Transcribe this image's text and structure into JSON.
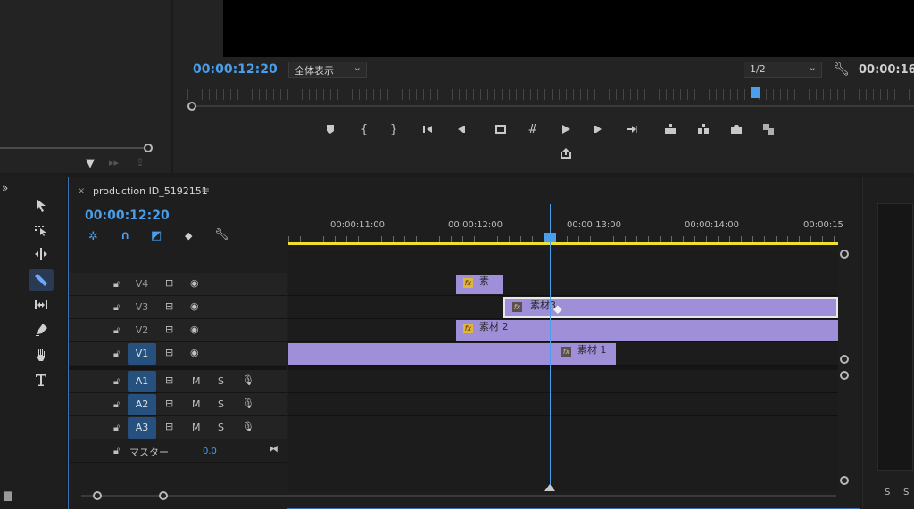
{
  "program_monitor": {
    "timecode": "00:00:12:20",
    "fit_dropdown": "全体表示",
    "resolution_dropdown": "1/2",
    "duration_timecode": "00:00:16:"
  },
  "timeline": {
    "sequence_name": "production ID_5192151",
    "timecode": "00:00:12:20",
    "ruler_labels": [
      "00:00:11:00",
      "00:00:12:00",
      "00:00:13:00",
      "00:00:14:00",
      "00:00:15"
    ],
    "video_tracks": [
      {
        "label": "V4",
        "targeted": false
      },
      {
        "label": "V3",
        "targeted": false
      },
      {
        "label": "V2",
        "targeted": false
      },
      {
        "label": "V1",
        "targeted": true
      }
    ],
    "audio_tracks": [
      {
        "label": "A1",
        "m": "M",
        "s": "S"
      },
      {
        "label": "A2",
        "m": "M",
        "s": "S"
      },
      {
        "label": "A3",
        "m": "M",
        "s": "S"
      }
    ],
    "master": {
      "label": "マスター",
      "value": "0.0"
    },
    "clips": {
      "v4": "素",
      "v3": "素材3",
      "v2": "素材 2",
      "v1": "素材 1"
    },
    "fx_badge": "fx"
  },
  "right_panel": {
    "s1": "S",
    "s2": "S"
  },
  "icons": [
    "filter-icon",
    "insert-icon",
    "export-icon",
    "marker-icon",
    "mark-in-icon",
    "mark-out-icon",
    "go-to-in-icon",
    "step-back-icon",
    "safe-margins-icon",
    "grid-icon",
    "play-icon",
    "step-forward-icon",
    "go-to-out-icon",
    "lift-icon",
    "extract-icon",
    "camera-icon",
    "compare-icon",
    "share-icon",
    "selection-tool-icon",
    "track-select-icon",
    "ripple-edit-icon",
    "razor-tool-icon",
    "slip-tool-icon",
    "pen-tool-icon",
    "hand-tool-icon",
    "type-tool-icon",
    "lock-icon",
    "toggle-output-icon",
    "eye-icon",
    "mic-icon",
    "wrench-icon",
    "snap-icon",
    "linked-selection-icon",
    "add-marker-icon"
  ]
}
